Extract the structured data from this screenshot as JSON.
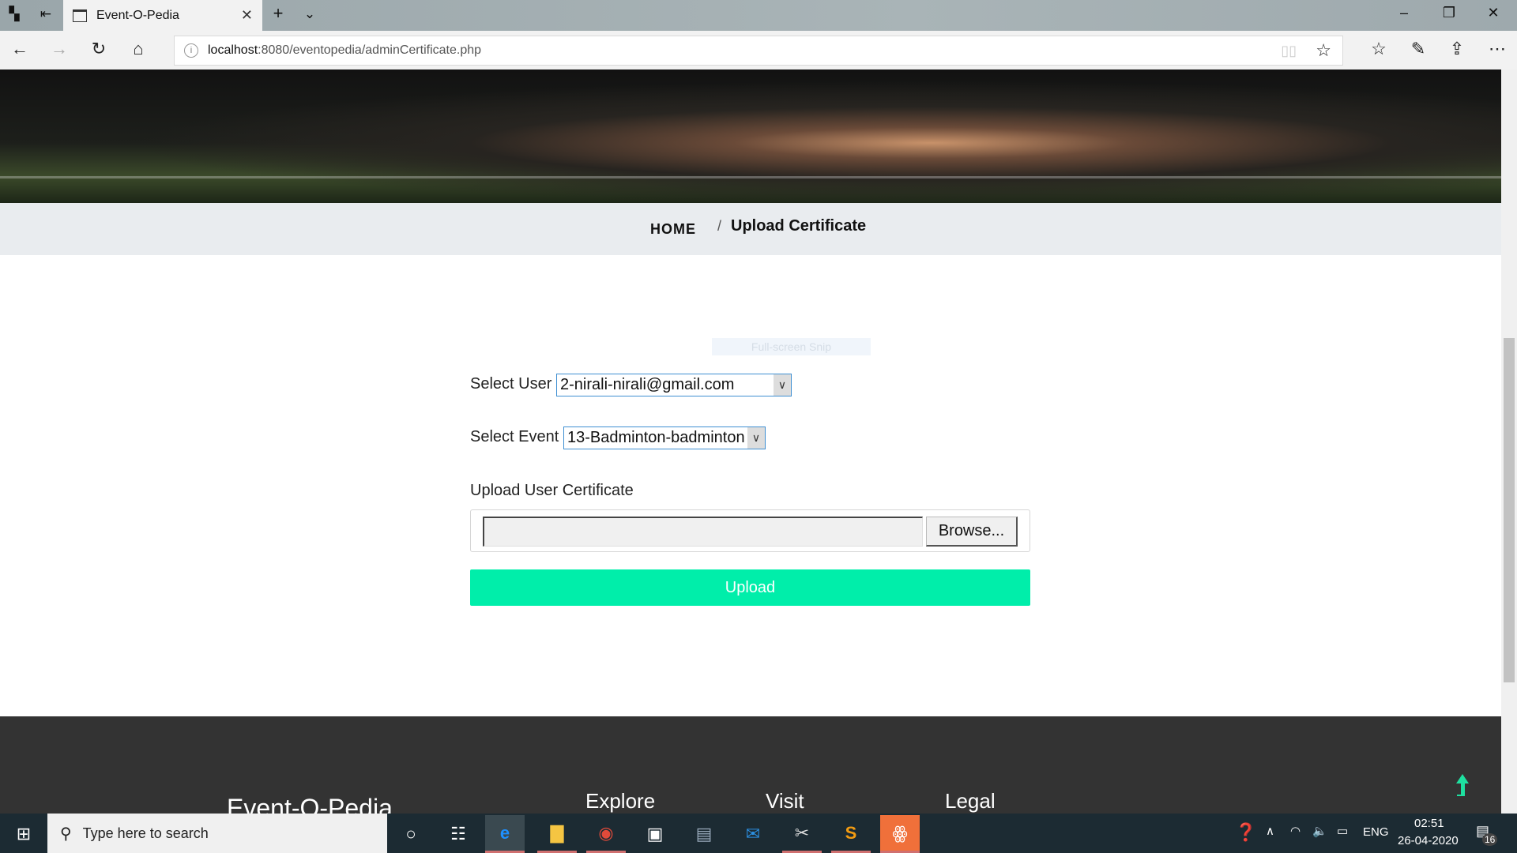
{
  "browser": {
    "tab_title": "Event-O-Pedia",
    "url_host": "localhost",
    "url_path": ":8080/eventopedia/adminCertificate.php"
  },
  "breadcrumb": {
    "home": "HOME",
    "separator": "/",
    "current": "Upload Certificate"
  },
  "overlay": {
    "snip_label": "Full-screen Snip"
  },
  "form": {
    "user_label": "Select User",
    "user_value": "2-nirali-nirali@gmail.com",
    "event_label": "Select Event",
    "event_value": "13-Badminton-badminton",
    "certificate_label": "Upload User Certificate",
    "browse_label": "Browse...",
    "upload_label": "Upload"
  },
  "footer": {
    "brand": "Event-O-Pedia",
    "columns": [
      "Explore",
      "Visit",
      "Legal"
    ]
  },
  "colors": {
    "accent": "#00eeaa",
    "footer_bg": "#333333",
    "crumb_bg": "#e9ecef"
  },
  "taskbar": {
    "search_placeholder": "Type here to search",
    "language": "ENG",
    "time": "02:51",
    "date": "26-04-2020",
    "notification_count": "16"
  }
}
